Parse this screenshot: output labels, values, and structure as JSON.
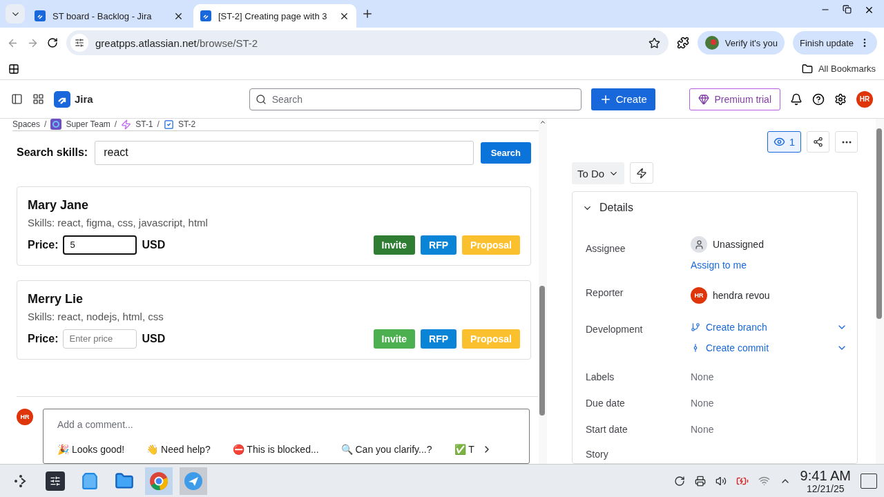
{
  "browser": {
    "tabs": [
      {
        "title": "ST board - Backlog - Jira",
        "selected": false
      },
      {
        "title": "[ST-2] Creating page with 3",
        "selected": true
      }
    ],
    "url": {
      "host": "greatpps.atlassian.net",
      "path": "/browse/ST-2"
    },
    "profile_chip": "Verify it's you",
    "update_chip": "Finish update",
    "bookmarks": "All Bookmarks"
  },
  "header": {
    "app_name": "Jira",
    "search_placeholder": "Search",
    "create": "Create",
    "premium": "Premium trial",
    "avatar": "HR"
  },
  "breadcrumbs": [
    {
      "label": "Spaces",
      "kind": "text",
      "separator": "/"
    },
    {
      "label": "Super Team",
      "kind": "project",
      "separator": "/"
    },
    {
      "label": "ST-1",
      "kind": "epic",
      "separator": "/"
    },
    {
      "label": "ST-2",
      "kind": "task"
    }
  ],
  "skill_search": {
    "label": "Search skills:",
    "value": "react",
    "button": "Search"
  },
  "freelancers": [
    {
      "name": "Mary Jane",
      "skills": "Skills: react, figma, css, javascript, html",
      "price_label": "Price:",
      "price": {
        "value": "5",
        "focused": true
      },
      "currency": "USD",
      "invite": {
        "label": "Invite",
        "pressed": true
      },
      "rfp": "RFP",
      "proposal": "Proposal"
    },
    {
      "name": "Merry Lie",
      "skills": "Skills: react, nodejs, html, css",
      "price_label": "Price:",
      "price": {
        "placeholder": "Enter price",
        "focused": false
      },
      "currency": "USD",
      "invite": {
        "label": "Invite",
        "pressed": false
      },
      "rfp": "RFP",
      "proposal": "Proposal"
    }
  ],
  "comment": {
    "avatar": "HR",
    "placeholder": "Add a comment...",
    "suggestions": [
      "🎉 Looks good!",
      "👋 Need help?",
      "⛔ This is blocked...",
      "🔍 Can you clarify...?",
      "✅ T"
    ]
  },
  "issue_panel": {
    "watchers": "1",
    "watching": true,
    "status": "To Do",
    "details": {
      "title": "Details",
      "expanded": true,
      "fields": [
        {
          "label": "Assignee",
          "kind": "assignee",
          "value": "Unassigned",
          "action": "Assign to me"
        },
        {
          "label": "Reporter",
          "kind": "user",
          "value": "hendra revou",
          "avatar": "HR"
        },
        {
          "label": "Development",
          "kind": "development",
          "links": [
            "Create branch",
            "Create commit"
          ]
        },
        {
          "label": "Labels",
          "kind": "text",
          "value": "None"
        },
        {
          "label": "Due date",
          "kind": "text",
          "value": "None"
        },
        {
          "label": "Start date",
          "kind": "text",
          "value": "None"
        },
        {
          "label": "Story",
          "kind": "text"
        }
      ]
    }
  },
  "taskbar": {
    "time": "9:41 AM",
    "date": "12/21/25"
  }
}
